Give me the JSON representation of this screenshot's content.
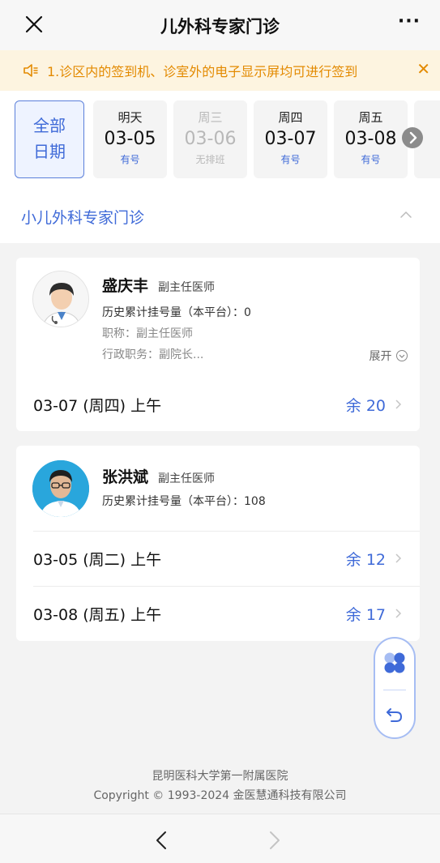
{
  "header": {
    "title": "儿外科专家门诊",
    "more": "···"
  },
  "notice": {
    "text": "1.诊区内的签到机、诊室外的电子显示屏均可进行签到"
  },
  "date_filter": {
    "all_line1": "全部",
    "all_line2": "日期",
    "days": [
      {
        "weekday": "明天",
        "date": "03-05",
        "status": "有号"
      },
      {
        "weekday": "周三",
        "date": "03-06",
        "status": "无排班"
      },
      {
        "weekday": "周四",
        "date": "03-07",
        "status": "有号"
      },
      {
        "weekday": "周五",
        "date": "03-08",
        "status": "有号"
      }
    ]
  },
  "department": {
    "name": "小儿外科专家门诊"
  },
  "doctors": [
    {
      "name": "盛庆丰",
      "title": "副主任医师",
      "history": "历史累计挂号量（本平台）：0",
      "rank": "职称：副主任医师",
      "admin": "行政职务：副院长...",
      "expand": "展开",
      "slots": [
        {
          "when": "03-07 (周四)   上午",
          "remaining": "余 20"
        }
      ]
    },
    {
      "name": "张洪斌",
      "title": "副主任医师",
      "history": "历史累计挂号量（本平台）：108",
      "slots": [
        {
          "when": "03-05 (周二)   上午",
          "remaining": "余 12"
        },
        {
          "when": "03-08 (周五)   上午",
          "remaining": "余 17"
        }
      ]
    }
  ],
  "footer": {
    "hospital": "昆明医科大学第一附属医院",
    "copyright": "Copyright © 1993-2024 金医慧通科技有限公司"
  },
  "colors": {
    "accent": "#3f6ad8",
    "notice": "#e38a00",
    "notice_bg": "#fdf4e0"
  }
}
